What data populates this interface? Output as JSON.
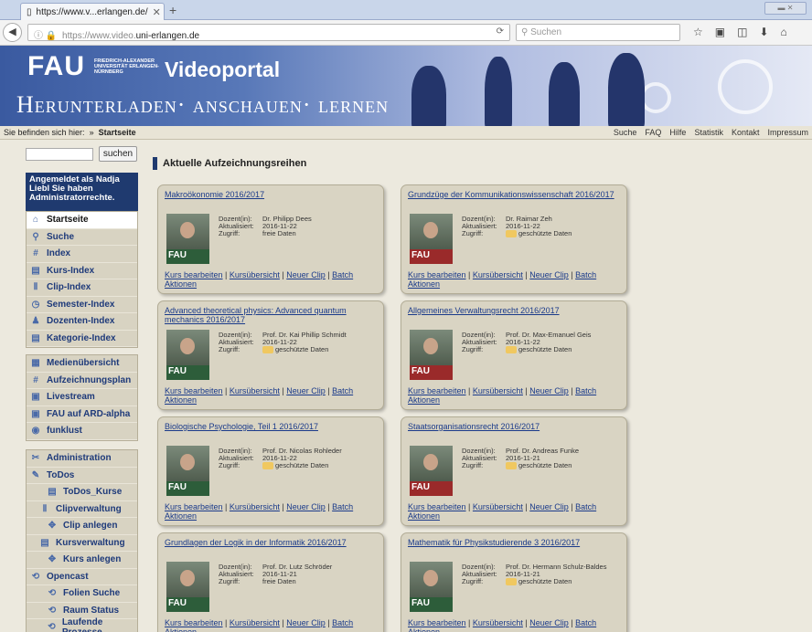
{
  "browser": {
    "tab_title": "https://www.v...erlangen.de/",
    "new_tab": "+",
    "url_prefix": "https://www.video.",
    "url_domain": "uni-erlangen.de",
    "search_placeholder": "Suchen"
  },
  "banner": {
    "logo": "FAU",
    "logo_sub": "FRIEDRICH-ALEXANDER UNIVERSITÄT ERLANGEN-NÜRNBERG",
    "title": "Videoportal",
    "tagline": "Herunterladen· anschauen· lernen"
  },
  "breadcrumb": {
    "prefix": "Sie befinden sich hier:",
    "current": "Startseite"
  },
  "topnav": [
    "Suche",
    "FAQ",
    "Hilfe",
    "Statistik",
    "Kontakt",
    "Impressum"
  ],
  "sidebar": {
    "search_button": "suchen",
    "login_text": "Angemeldet als Nadja Liebl Sie haben Administratorrechte.",
    "menu1": [
      {
        "label": "Startseite",
        "icon": "home-icon",
        "glyph": "⌂"
      },
      {
        "label": "Suche",
        "icon": "search-icon",
        "glyph": "⚲"
      },
      {
        "label": "Index",
        "icon": "hash-icon",
        "glyph": "#"
      },
      {
        "label": "Kurs-Index",
        "icon": "course-icon",
        "glyph": "▤"
      },
      {
        "label": "Clip-Index",
        "icon": "clip-icon",
        "glyph": "Ⅱ"
      },
      {
        "label": "Semester-Index",
        "icon": "clock-icon",
        "glyph": "◷"
      },
      {
        "label": "Dozenten-Index",
        "icon": "people-icon",
        "glyph": "♟"
      },
      {
        "label": "Kategorie-Index",
        "icon": "category-icon",
        "glyph": "▤"
      }
    ],
    "menu2": [
      {
        "label": "Medienübersicht",
        "icon": "media-icon",
        "glyph": "▦"
      },
      {
        "label": "Aufzeichnungsplan",
        "icon": "hash-icon",
        "glyph": "#"
      },
      {
        "label": "Livestream",
        "icon": "livestream-icon",
        "glyph": "▣"
      },
      {
        "label": "FAU auf ARD-alpha",
        "icon": "tv-icon",
        "glyph": "▣"
      },
      {
        "label": "funklust",
        "icon": "radio-icon",
        "glyph": "◉"
      }
    ],
    "menu3": [
      {
        "label": "Administration",
        "icon": "tools-icon",
        "glyph": "✂"
      },
      {
        "label": "ToDos",
        "icon": "todo-icon",
        "glyph": "✎"
      },
      {
        "label": "ToDos_Kurse",
        "icon": "list-icon",
        "glyph": "▤"
      },
      {
        "label": "Clipverwaltung",
        "icon": "clip-icon",
        "glyph": "Ⅱ"
      },
      {
        "label": "Clip anlegen",
        "icon": "add-icon",
        "glyph": "✥"
      },
      {
        "label": "Kursverwaltung",
        "icon": "course-icon",
        "glyph": "▤"
      },
      {
        "label": "Kurs anlegen",
        "icon": "add-icon",
        "glyph": "✥"
      },
      {
        "label": "Opencast",
        "icon": "opencast-icon",
        "glyph": "⟲"
      },
      {
        "label": "Folien Suche",
        "icon": "opencast-icon",
        "glyph": "⟲"
      },
      {
        "label": "Raum Status",
        "icon": "opencast-icon",
        "glyph": "⟲"
      },
      {
        "label": "Laufende Prozesse",
        "icon": "opencast-icon",
        "glyph": "⟲"
      }
    ]
  },
  "content": {
    "heading": "Aktuelle Aufzeichnungsreihen",
    "labels": {
      "lecturer": "Dozent(in):",
      "updated": "Aktualisiert:",
      "access": "Zugriff:"
    },
    "links": {
      "edit": "Kurs bearbeiten",
      "overview": "Kursübersicht",
      "new_clip": "Neuer Clip",
      "batch": "Batch Aktionen"
    },
    "courses": [
      {
        "title": "Makroökonomie 2016/2017",
        "lecturer": "Dr. Philipp Dees",
        "updated": "2016-11-22",
        "access": "freie Daten",
        "logo_color": "green"
      },
      {
        "title": "Grundzüge der Kommunikationswissenschaft 2016/2017",
        "lecturer": "Dr. Raimar Zeh",
        "updated": "2016-11-22",
        "access": "geschützte Daten",
        "logo_color": "red"
      },
      {
        "title": "Advanced theoretical physics: Advanced quantum mechanics 2016/2017",
        "lecturer": "Prof. Dr. Kai Phillip Schmidt",
        "updated": "2016-11-22",
        "access": "geschützte Daten",
        "logo_color": "green"
      },
      {
        "title": "Allgemeines Verwaltungsrecht 2016/2017",
        "lecturer": "Prof. Dr. Max-Emanuel Geis",
        "updated": "2016-11-22",
        "access": "geschützte Daten",
        "logo_color": "red"
      },
      {
        "title": "Biologische Psychologie, Teil 1 2016/2017",
        "lecturer": "Prof. Dr. Nicolas Rohleder",
        "updated": "2016-11-22",
        "access": "geschützte Daten",
        "logo_color": "green"
      },
      {
        "title": "Staatsorganisationsrecht 2016/2017",
        "lecturer": "Prof. Dr. Andreas Funke",
        "updated": "2016-11-21",
        "access": "geschützte Daten",
        "logo_color": "red"
      },
      {
        "title": "Grundlagen der Logik in der Informatik 2016/2017",
        "lecturer": "Prof. Dr. Lutz Schröder",
        "updated": "2016-11-21",
        "access": "freie Daten",
        "logo_color": "green"
      },
      {
        "title": "Mathematik für Physikstudierende 3 2016/2017",
        "lecturer": "Prof. Dr. Hermann Schulz-Baldes",
        "updated": "2016-11-21",
        "access": "geschützte Daten",
        "logo_color": "green"
      }
    ]
  }
}
